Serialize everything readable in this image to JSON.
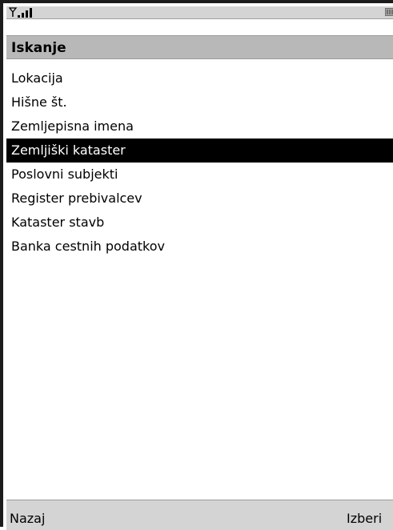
{
  "status_bar": {
    "signal_icon": "signal-strength-icon",
    "battery_icon": "battery-icon"
  },
  "title": "Iskanje",
  "menu": {
    "items": [
      {
        "label": "Lokacija",
        "selected": false
      },
      {
        "label": "Hišne št.",
        "selected": false
      },
      {
        "label": "Zemljepisna imena",
        "selected": false
      },
      {
        "label": "Zemljiški kataster",
        "selected": true
      },
      {
        "label": "Poslovni subjekti",
        "selected": false
      },
      {
        "label": "Register prebivalcev",
        "selected": false
      },
      {
        "label": "Kataster stavb",
        "selected": false
      },
      {
        "label": "Banka cestnih podatkov",
        "selected": false
      }
    ]
  },
  "softkeys": {
    "left": "Nazaj",
    "right": "Izberi"
  },
  "colors": {
    "selection_background": "#000000",
    "selection_text": "#ffffff",
    "title_bar": "#b8b8b8",
    "status_bar": "#d4d4d4"
  }
}
